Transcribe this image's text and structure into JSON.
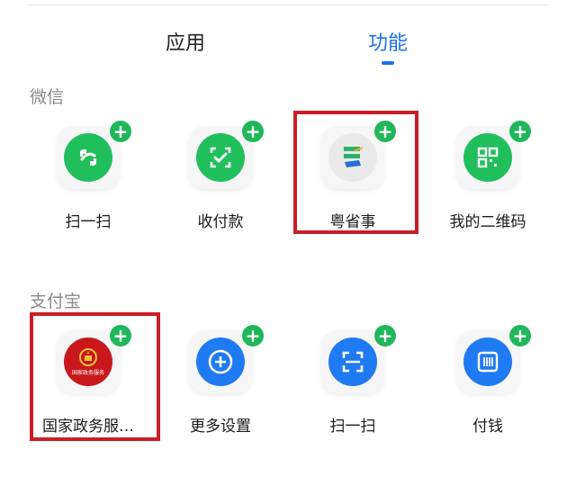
{
  "tabs": [
    {
      "label": "应用"
    },
    {
      "label": "功能"
    }
  ],
  "active_tab": "功能",
  "sections": {
    "wechat": {
      "title": "微信",
      "items": [
        {
          "label": "扫一扫",
          "icon": "wechat-scan-icon"
        },
        {
          "label": "收付款",
          "icon": "wechat-payment-icon"
        },
        {
          "label": "粤省事",
          "icon": "yueshengshi-icon"
        },
        {
          "label": "我的二维码",
          "icon": "qr-code-icon"
        }
      ]
    },
    "alipay": {
      "title": "支付宝",
      "items": [
        {
          "label": "国家政务服…",
          "icon": "national-emblem-icon",
          "emblem_text": "国家政务服务"
        },
        {
          "label": "更多设置",
          "icon": "plus-circle-icon"
        },
        {
          "label": "扫一扫",
          "icon": "scan-frame-icon"
        },
        {
          "label": "付钱",
          "icon": "barcode-icon"
        }
      ]
    }
  },
  "add_badge": "+",
  "colors": {
    "accent": "#1e6ff0",
    "wechat_green": "#21bf5c",
    "alipay_blue": "#1f7af3",
    "highlight_red": "#c81e26"
  }
}
